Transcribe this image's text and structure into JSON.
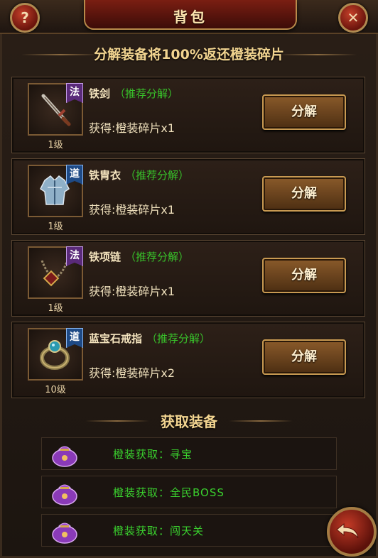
{
  "header": {
    "title": "背包",
    "help_label": "?",
    "close_label": "✕"
  },
  "info_text": "分解装备将100%返还橙装碎片",
  "items": [
    {
      "name": "铁剑",
      "tag": "法",
      "recommend": "（推荐分解）",
      "reward": "获得:橙装碎片x1",
      "level": "1级",
      "button": "分解",
      "icon": "sword-icon"
    },
    {
      "name": "铁胄衣",
      "tag": "道",
      "recommend": "（推荐分解）",
      "reward": "获得:橙装碎片x1",
      "level": "1级",
      "button": "分解",
      "icon": "armor-icon"
    },
    {
      "name": "铁项链",
      "tag": "法",
      "recommend": "（推荐分解）",
      "reward": "获得:橙装碎片x1",
      "level": "1级",
      "button": "分解",
      "icon": "necklace-icon"
    },
    {
      "name": "蓝宝石戒指",
      "tag": "道",
      "recommend": "（推荐分解）",
      "reward": "获得:橙装碎片x2",
      "level": "10级",
      "button": "分解",
      "icon": "ring-icon"
    }
  ],
  "acquire": {
    "title": "获取装备",
    "rows": [
      {
        "text": "橙装获取：寻宝",
        "icon": "treasure-bag-icon"
      },
      {
        "text": "橙装获取：全民BOSS",
        "icon": "treasure-bag-icon"
      },
      {
        "text": "橙装获取：闯天关",
        "icon": "treasure-bag-icon"
      }
    ]
  },
  "colors": {
    "recommend_green": "#38c02a",
    "acquire_green": "#3ad02e",
    "gold_text": "#f2d490"
  }
}
